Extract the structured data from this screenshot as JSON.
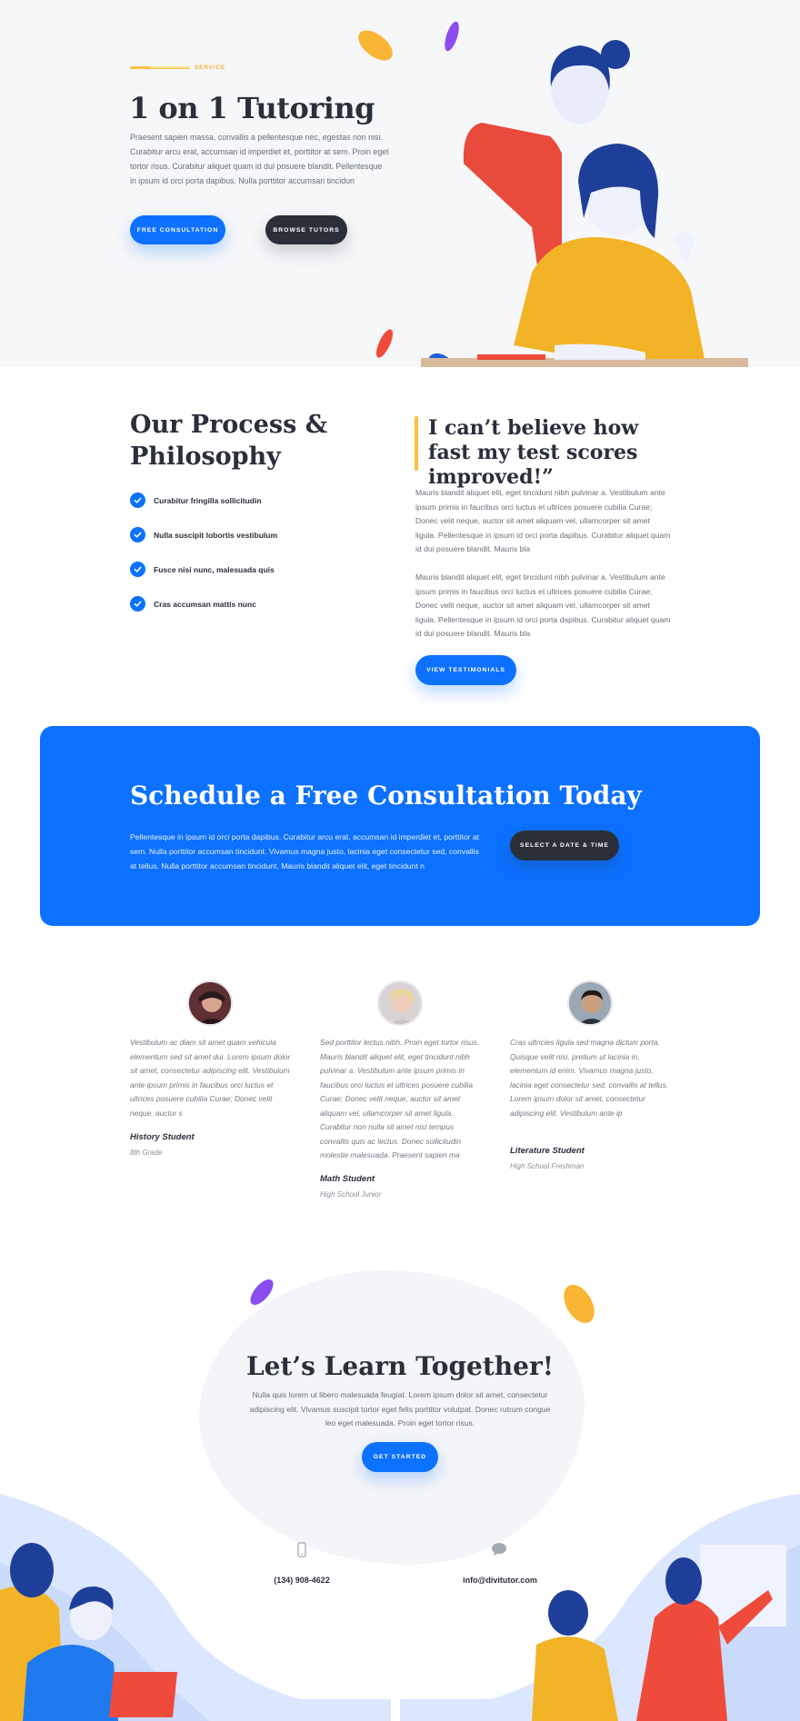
{
  "hero": {
    "eyebrow": "SERVICE",
    "title": "1 on 1 Tutoring",
    "text": "Praesent sapien massa, convallis a pellentesque nec, egestas non nisi. Curabitur arcu erat, accumsan id imperdiet et, porttitor at sem. Proin eget tortor risus. Curabitur aliquet quam id dui posuere blandit. Pellentesque in ipsum id orci porta dapibus. Nulla porttitor accumsan tincidun",
    "primary_button": "FREE CONSULTATION",
    "secondary_button": "BROWSE TUTORS"
  },
  "process": {
    "title": "Our Process & Philosophy",
    "checklist": [
      "Curabitur fringilla sollicitudin",
      "Nulla suscipit lobortis vestibulum",
      "Fusce nisi nunc, malesuada quis",
      "Cras accumsan mattis nunc"
    ],
    "quote": "I can’t believe how fast my test scores improved!”",
    "paragraphs": [
      "Mauris blandit aliquet elit, eget tincidunt nibh pulvinar a. Vestibulum ante ipsum primis in faucibus orci luctus et ultrices posuere cubilia Curae; Donec velit neque, auctor sit amet aliquam vel, ullamcorper sit amet ligula. Pellentesque in ipsum id orci porta dapibus. Curabitur aliquet quam id dui posuere blandit. Mauris bla",
      "Mauris blandit aliquet elit, eget tincidunt nibh pulvinar a. Vestibulum ante ipsum primis in faucibus orci luctus et ultrices posuere cubilia Curae; Donec velit neque, auctor sit amet aliquam vel, ullamcorper sit amet ligula. Pellentesque in ipsum id orci porta dapibus. Curabitur aliquet quam id dui posuere blandit. Mauris bla"
    ],
    "button": "VIEW TESTIMONIALS"
  },
  "cta": {
    "title": "Schedule a Free Consultation Today",
    "text": "Pellentesque in ipsum id orci porta dapibus. Curabitur arcu erat, accumsan id imperdiet et, porttitor at sem. Nulla porttitor accumsan tincidunt. Vivamus magna justo, lacinia eget consectetur sed, convallis at tellus. Nulla porttitor accumsan tincidunt. Mauris blandit aliquet elit, eget tincidunt n",
    "button": "SELECT A DATE & TIME"
  },
  "testimonials": [
    {
      "text": "Vestibulum ac diam sit amet quam vehicula elementum sed sit amet dui. Lorem ipsum dolor sit amet, consectetur adipiscing elit. Vestibulum ante ipsum primis in faucibus orci luctus et ultrices posuere cubilia Curae; Donec velit neque, auctor s",
      "name": "History Student",
      "grade": "8th Grade"
    },
    {
      "text": "Sed porttitor lectus nibh. Proin eget tortor risus. Mauris blandit aliquet elit, eget tincidunt nibh pulvinar a. Vestibulum ante ipsum primis in faucibus orci luctus et ultrices posuere cubilia Curae; Donec velit neque, auctor sit amet aliquam vel, ullamcorper sit amet ligula. Curabitur non nulla sit amet nisl tempus convallis quis ac lectus. Donec sollicitudin molestie malesuada. Praesent sapien ma",
      "name": "Math Student",
      "grade": "High School Junior"
    },
    {
      "text": "Cras ultricies ligula sed magna dictum porta. Quisque velit nisi, pretium ut lacinia in, elementum id enim. Vivamus magna justo, lacinia eget consectetur sed, convallis at tellus. Lorem ipsum dolor sit amet, consectetur adipiscing elit. Vestibulum ante ip",
      "name": "Literature Student",
      "grade": "High School Freshman"
    }
  ],
  "footer": {
    "title": "Let’s Learn Together!",
    "text": "Nulla quis lorem ut libero malesuada feugiat. Lorem ipsum dolor sit amet, consectetur adipiscing elit. Vivamus suscipit tortor eget felis porttitor volutpat. Donec rutrum congue leo eget malesuada. Proin eget tortor risus.",
    "button": "GET STARTED",
    "phone": "(134) 908-4622",
    "email": "info@divitutor.com",
    "phone_icon": "phone-icon",
    "email_icon": "chat-bubble-icon"
  },
  "colors": {
    "primary": "#0c71ff",
    "dark": "#2a2f3a",
    "accent_yellow": "#f9c03f",
    "accent_purple": "#8a4df0",
    "accent_red": "#ef4b3b"
  }
}
